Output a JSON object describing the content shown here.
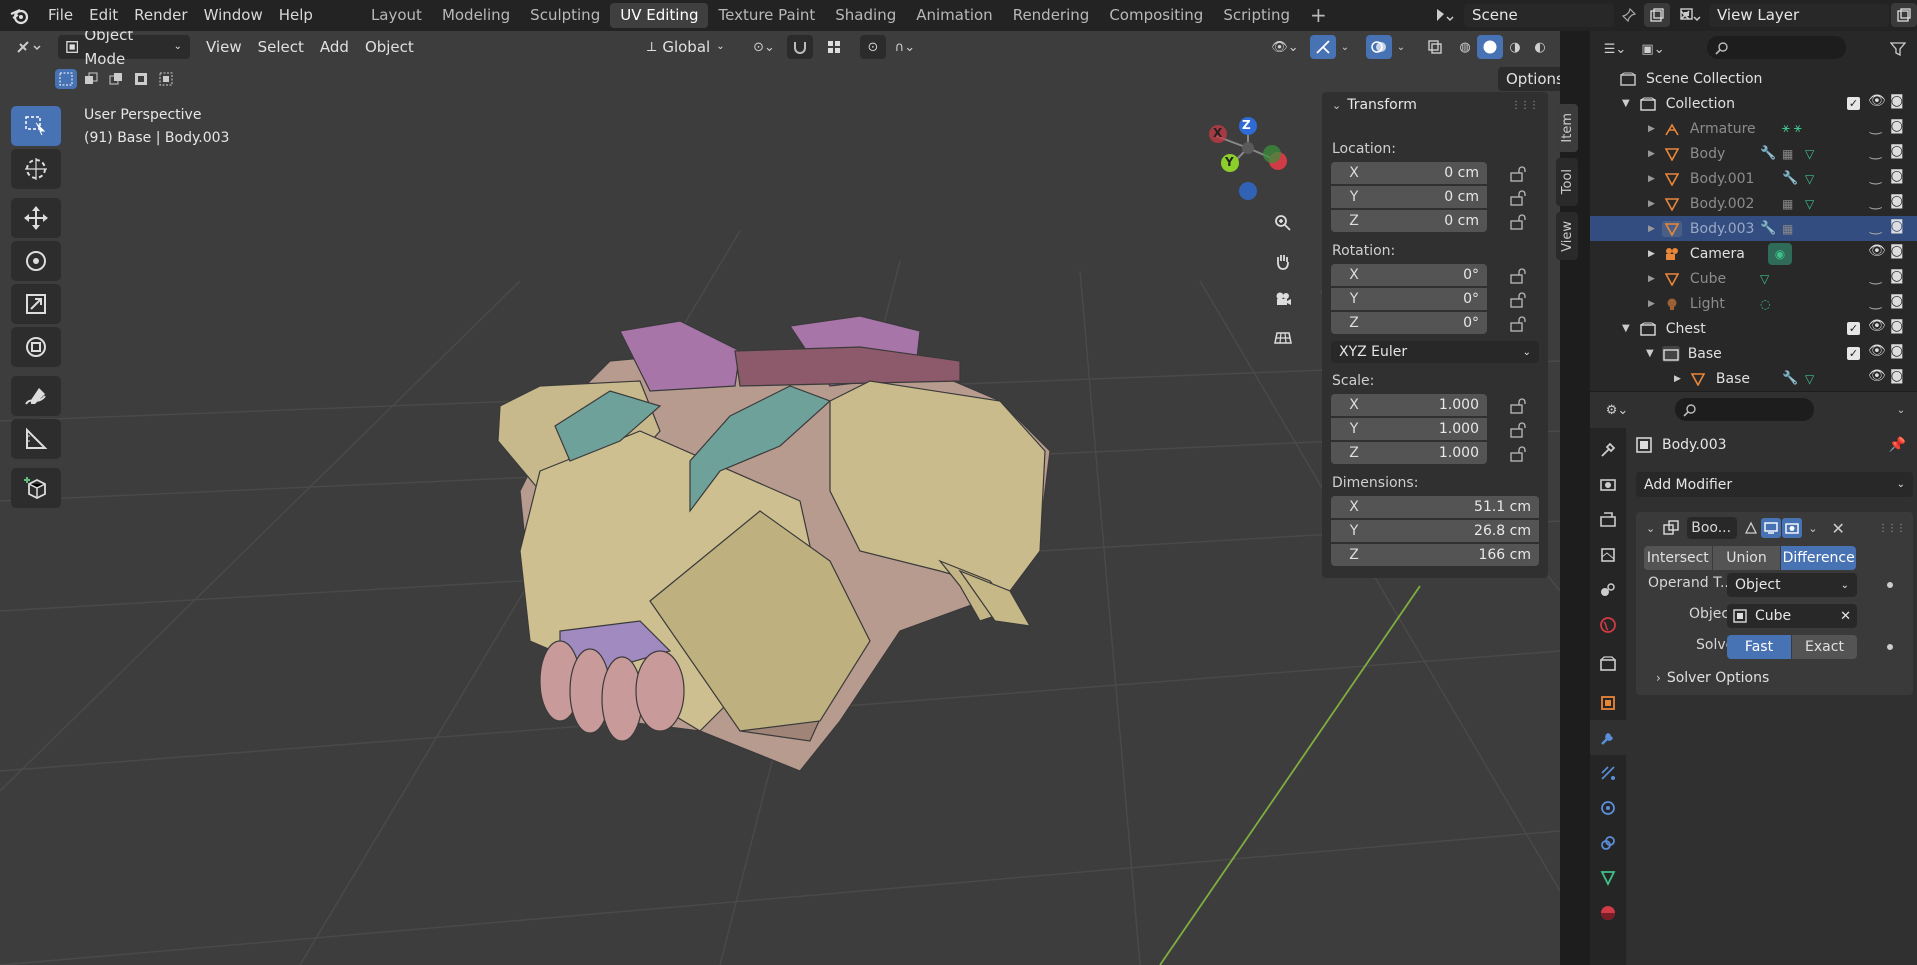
{
  "topbar": {
    "menus": [
      "File",
      "Edit",
      "Render",
      "Window",
      "Help"
    ],
    "workspaces": [
      "Layout",
      "Modeling",
      "Sculpting",
      "UV Editing",
      "Texture Paint",
      "Shading",
      "Animation",
      "Rendering",
      "Compositing",
      "Scripting"
    ],
    "active_workspace": "UV Editing",
    "add_workspace": "+",
    "scene": "Scene",
    "view_layer": "View Layer"
  },
  "viewport": {
    "mode": "Object Mode",
    "menus": [
      "View",
      "Select",
      "Add",
      "Object"
    ],
    "orientation": "Global",
    "options_label": "Options",
    "perspective_label": "User Perspective",
    "object_label": "(91) Base | Body.003",
    "gizmo": {
      "z": "Z",
      "y": "Y",
      "x": "X"
    }
  },
  "npanel": {
    "title": "Transform",
    "location_label": "Location:",
    "location": [
      {
        "axis": "X",
        "value": "0 cm"
      },
      {
        "axis": "Y",
        "value": "0 cm"
      },
      {
        "axis": "Z",
        "value": "0 cm"
      }
    ],
    "rotation_label": "Rotation:",
    "rotation": [
      {
        "axis": "X",
        "value": "0°"
      },
      {
        "axis": "Y",
        "value": "0°"
      },
      {
        "axis": "Z",
        "value": "0°"
      }
    ],
    "rotation_mode": "XYZ Euler",
    "scale_label": "Scale:",
    "scale": [
      {
        "axis": "X",
        "value": "1.000"
      },
      {
        "axis": "Y",
        "value": "1.000"
      },
      {
        "axis": "Z",
        "value": "1.000"
      }
    ],
    "dimensions_label": "Dimensions:",
    "dimensions": [
      {
        "axis": "X",
        "value": "51.1 cm"
      },
      {
        "axis": "Y",
        "value": "26.8 cm"
      },
      {
        "axis": "Z",
        "value": "166 cm"
      }
    ],
    "tabs": [
      "Item",
      "Tool",
      "View"
    ]
  },
  "outliner": {
    "root": "Scene Collection",
    "rows": [
      {
        "name": "Collection",
        "dim": false
      },
      {
        "name": "Armature",
        "dim": true
      },
      {
        "name": "Body",
        "dim": true
      },
      {
        "name": "Body.001",
        "dim": true
      },
      {
        "name": "Body.002",
        "dim": true
      },
      {
        "name": "Body.003",
        "dim": true
      },
      {
        "name": "Camera",
        "dim": false
      },
      {
        "name": "Cube",
        "dim": true
      },
      {
        "name": "Light",
        "dim": true
      },
      {
        "name": "Chest",
        "dim": false
      },
      {
        "name": "Base",
        "dim": false
      },
      {
        "name": "Base",
        "dim": false
      }
    ]
  },
  "properties": {
    "object_name": "Body.003",
    "add_modifier": "Add Modifier",
    "modifier_name": "Boo...",
    "operations": [
      "Intersect",
      "Union",
      "Difference"
    ],
    "active_operation": "Difference",
    "operand_label": "Operand T...",
    "operand_value": "Object",
    "object_label": "Object",
    "object_value": "Cube",
    "solver_label": "Solver",
    "solvers": [
      "Fast",
      "Exact"
    ],
    "active_solver": "Fast",
    "solver_options": "Solver Options"
  },
  "colors": {
    "accent": "#4772b3",
    "selected_row": "#334d80",
    "viewport_bg": "#3d3d3d",
    "object_orange": "#e8863a",
    "mesh_green": "#3fc08b",
    "modifier_blue": "#5a8ed8"
  }
}
